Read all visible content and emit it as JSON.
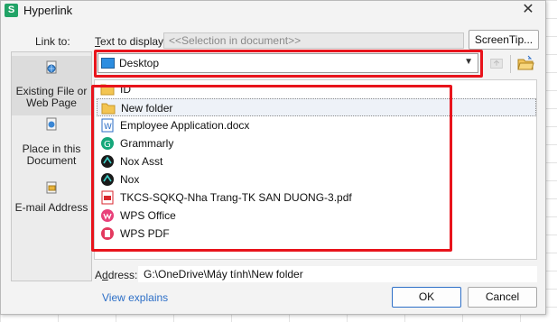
{
  "window": {
    "title": "Hyperlink",
    "close_label": "✕",
    "app_icon": "S"
  },
  "link_to": {
    "label": "Link to:",
    "items": [
      {
        "label": "Existing File or Web Page",
        "icon": "file-globe-icon"
      },
      {
        "label": "Place in this Document",
        "icon": "document-icon"
      },
      {
        "label": "E-mail Address",
        "icon": "email-icon"
      }
    ]
  },
  "text_to_display": {
    "label": "Text to display:",
    "value": "<<Selection in document>>"
  },
  "screentip_label": "ScreenTip...",
  "location": {
    "value": "Desktop",
    "icon": "desktop-icon"
  },
  "files": [
    {
      "name": "ID",
      "icon": "folder-icon"
    },
    {
      "name": "New folder",
      "icon": "folder-icon"
    },
    {
      "name": "Employee Application.docx",
      "icon": "word-doc-icon"
    },
    {
      "name": "Grammarly",
      "icon": "grammarly-icon"
    },
    {
      "name": "Nox Asst",
      "icon": "nox-icon"
    },
    {
      "name": "Nox",
      "icon": "nox-icon"
    },
    {
      "name": "TKCS-SQKQ-Nha Trang-TK SAN DUONG-3.pdf",
      "icon": "pdf-icon"
    },
    {
      "name": "WPS Office",
      "icon": "wps-office-icon"
    },
    {
      "name": "WPS PDF",
      "icon": "wps-pdf-icon"
    }
  ],
  "selected_file": "New folder",
  "address": {
    "label": "Address:",
    "value": "G:\\OneDrive\\Máy tính\\New folder"
  },
  "view_explains": "View explains",
  "ok_label": "OK",
  "cancel_label": "Cancel",
  "colors": {
    "highlight": "#e8141c",
    "accent": "#2d6fc7",
    "app": "#21a366"
  }
}
